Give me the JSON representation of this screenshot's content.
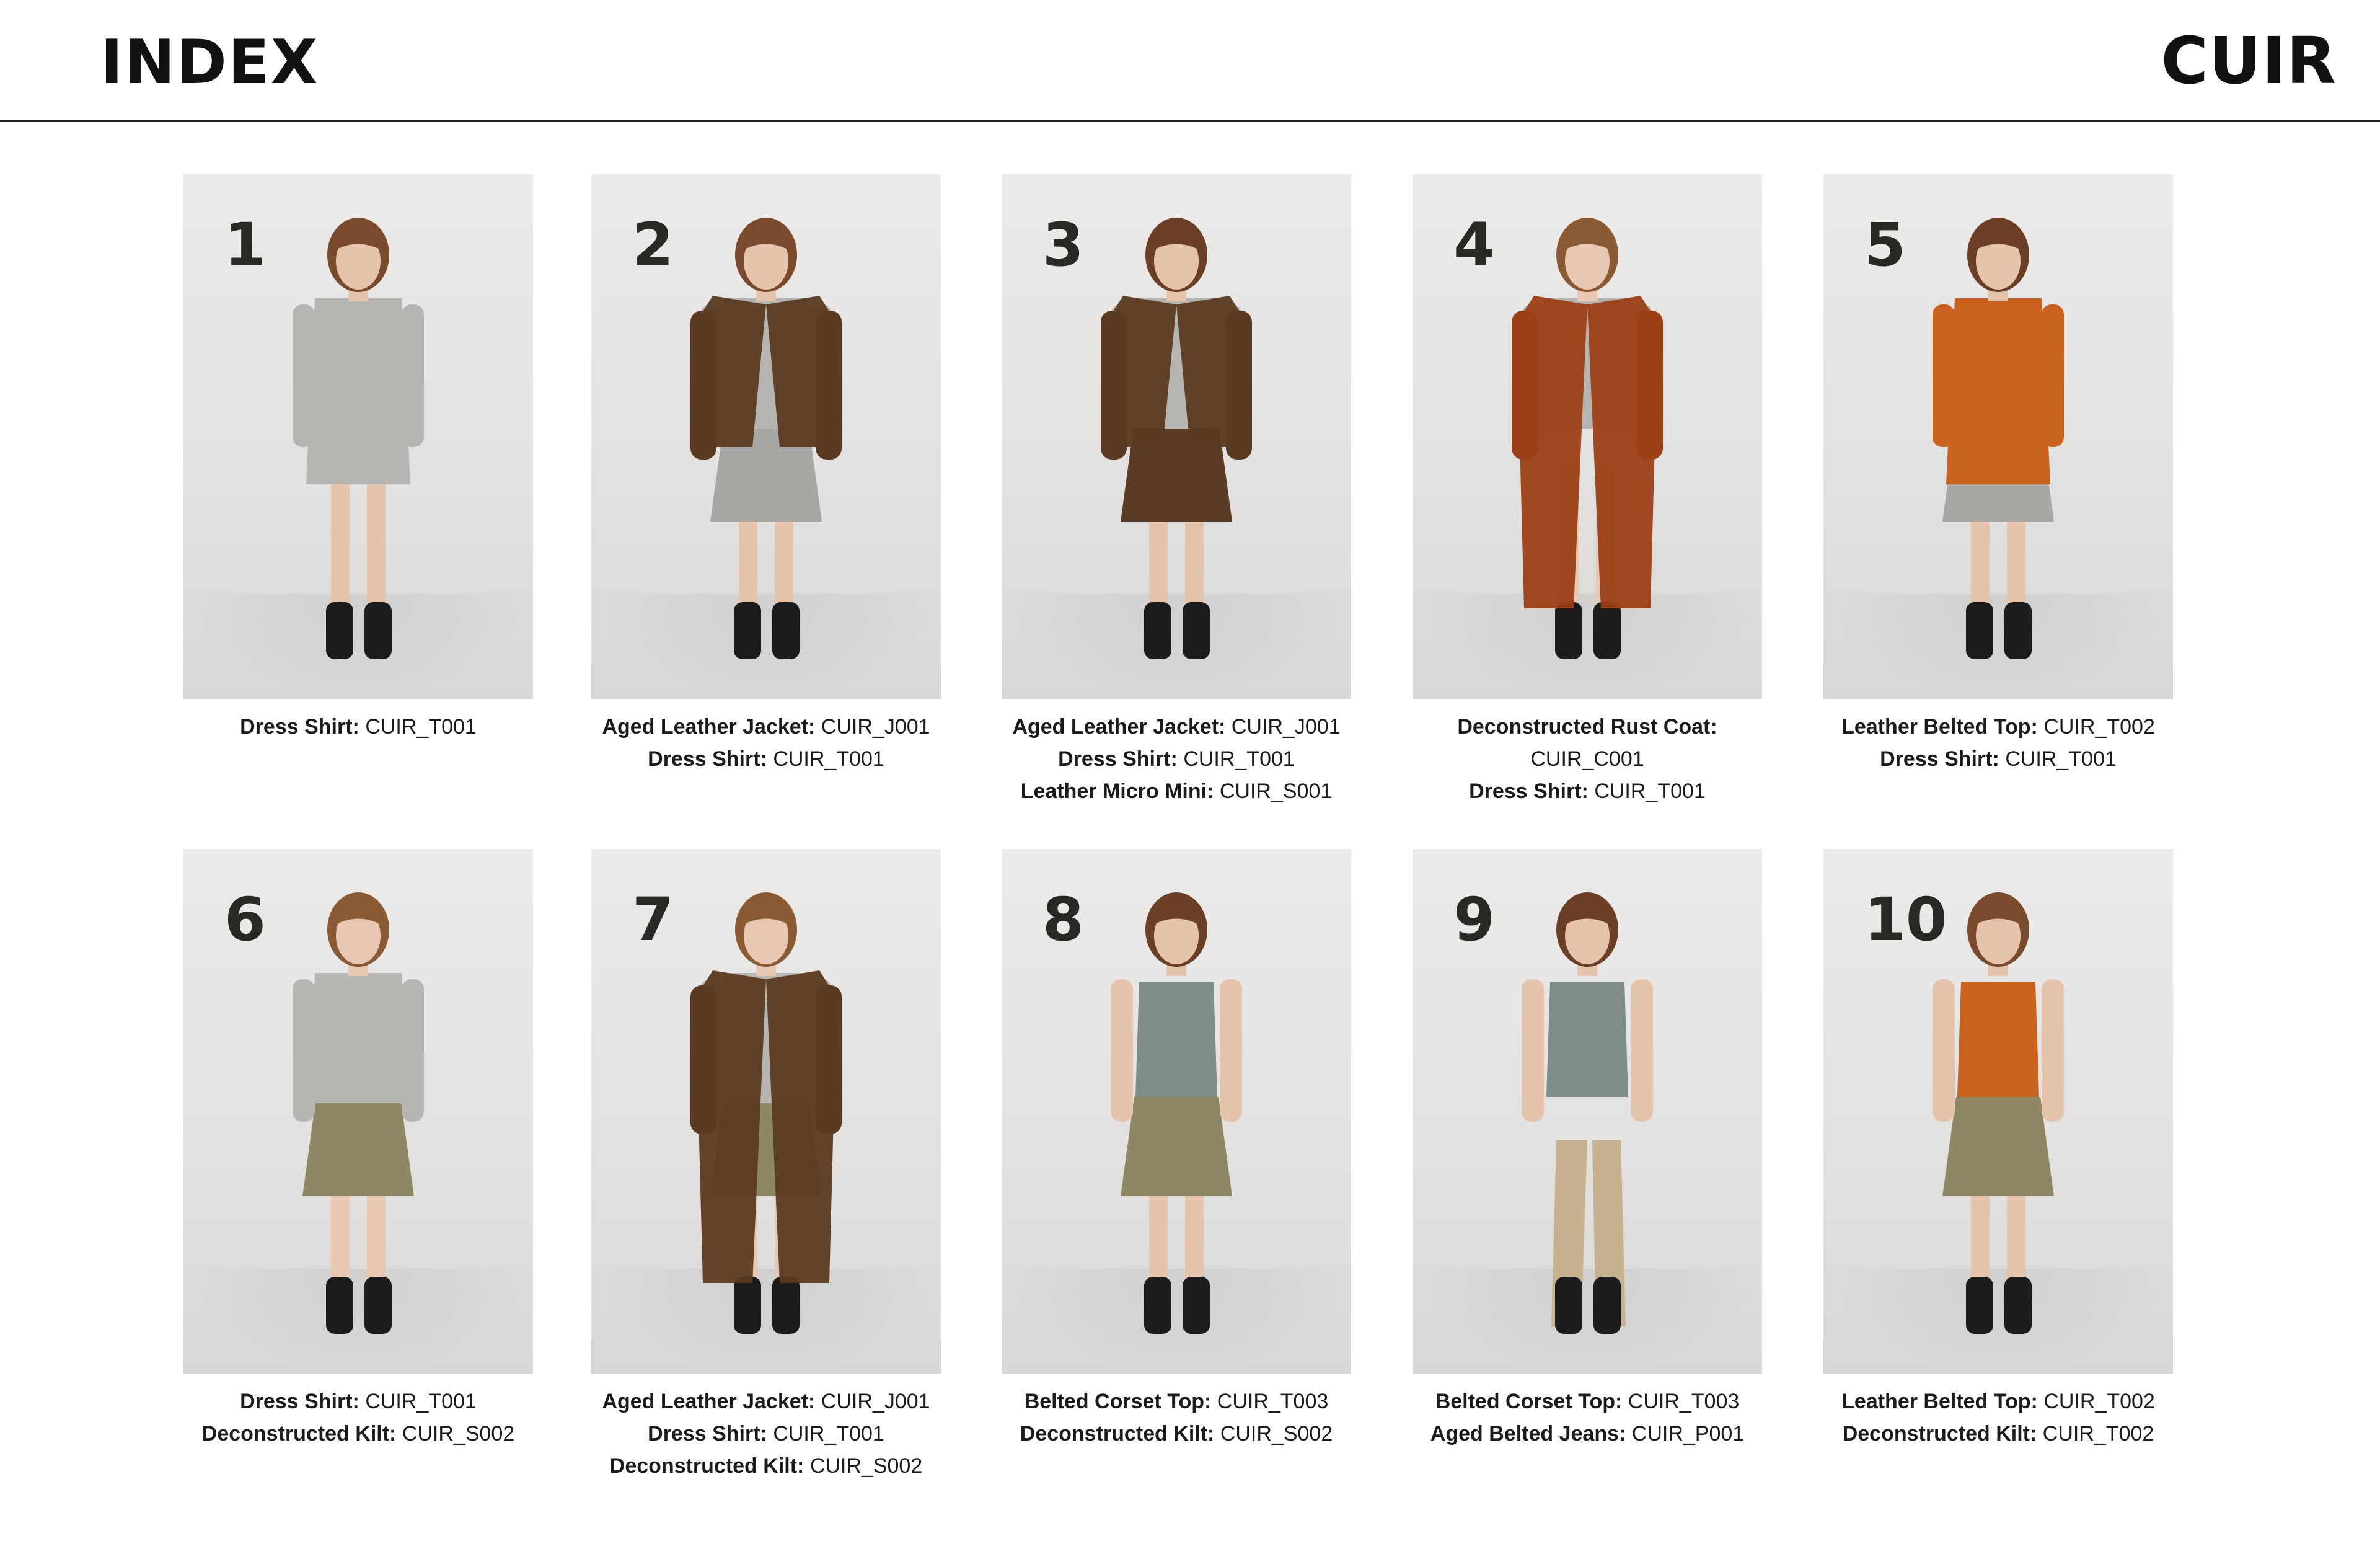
{
  "header": {
    "title": "INDEX",
    "brand": "CUIR"
  },
  "looks": [
    {
      "number": "1",
      "items": [
        {
          "name": "Dress Shirt:",
          "code": "CUIR_T001"
        }
      ]
    },
    {
      "number": "2",
      "items": [
        {
          "name": "Aged Leather Jacket:",
          "code": "CUIR_J001"
        },
        {
          "name": "Dress Shirt:",
          "code": "CUIR_T001"
        }
      ]
    },
    {
      "number": "3",
      "items": [
        {
          "name": "Aged Leather Jacket:",
          "code": "CUIR_J001"
        },
        {
          "name": "Dress Shirt:",
          "code": "CUIR_T001"
        },
        {
          "name": "Leather Micro Mini:",
          "code": "CUIR_S001"
        }
      ]
    },
    {
      "number": "4",
      "items": [
        {
          "name": "Deconstructed Rust Coat:",
          "code": "CUIR_C001"
        },
        {
          "name": "Dress Shirt:",
          "code": "CUIR_T001"
        }
      ]
    },
    {
      "number": "5",
      "items": [
        {
          "name": "Leather Belted Top:",
          "code": "CUIR_T002"
        },
        {
          "name": "Dress Shirt:",
          "code": "CUIR_T001"
        }
      ]
    },
    {
      "number": "6",
      "items": [
        {
          "name": "Dress Shirt:",
          "code": "CUIR_T001"
        },
        {
          "name": "Deconstructed Kilt:",
          "code": "CUIR_S002"
        }
      ]
    },
    {
      "number": "7",
      "items": [
        {
          "name": "Aged Leather Jacket:",
          "code": "CUIR_J001"
        },
        {
          "name": "Dress Shirt:",
          "code": "CUIR_T001"
        },
        {
          "name": "Deconstructed Kilt:",
          "code": "CUIR_S002"
        }
      ]
    },
    {
      "number": "8",
      "items": [
        {
          "name": "Belted Corset Top:",
          "code": "CUIR_T003"
        },
        {
          "name": "Deconstructed Kilt:",
          "code": "CUIR_S002"
        }
      ]
    },
    {
      "number": "9",
      "items": [
        {
          "name": "Belted Corset Top:",
          "code": "CUIR_T003"
        },
        {
          "name": "Aged Belted Jeans:",
          "code": "CUIR_P001"
        }
      ]
    },
    {
      "number": "10",
      "items": [
        {
          "name": "Leather Belted Top:",
          "code": "CUIR_T002"
        },
        {
          "name": "Deconstructed Kilt:",
          "code": "CUIR_T002"
        }
      ]
    }
  ]
}
